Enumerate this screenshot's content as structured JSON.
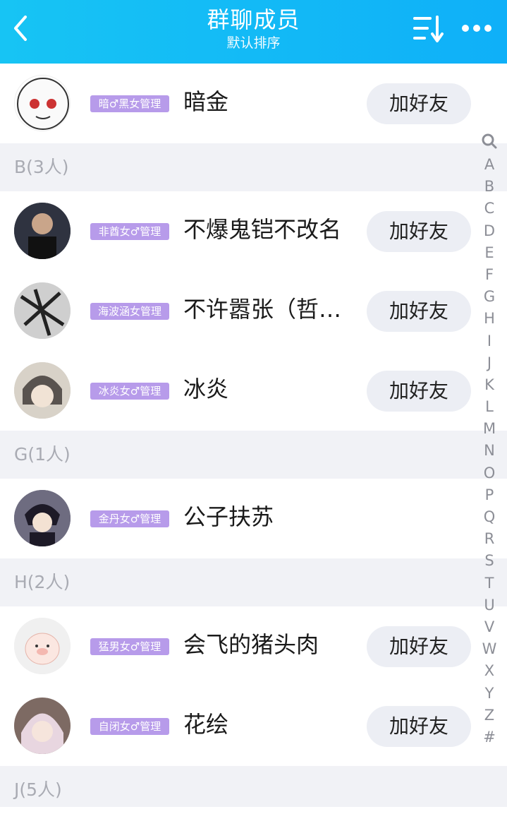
{
  "header": {
    "title": "群聊成员",
    "subtitle": "默认排序"
  },
  "members_top": {
    "name": "暗金",
    "badge": "暗♂黑女管理",
    "action": "加好友"
  },
  "sections": [
    {
      "label": "B(3人)"
    },
    {
      "label": "G(1人)"
    },
    {
      "label": "H(2人)"
    },
    {
      "label": "J(5人)"
    }
  ],
  "members": [
    {
      "name": "不爆鬼铠不改名",
      "badge": "非酋女♂管理",
      "action": "加好友"
    },
    {
      "name": "不许嚣张（哲…",
      "badge": "海波涵女管理",
      "action": "加好友"
    },
    {
      "name": "冰炎",
      "badge": "冰炎女♂管理",
      "action": "加好友"
    },
    {
      "name": "公子扶苏",
      "badge": "金丹女♂管理",
      "action": ""
    },
    {
      "name": "会飞的猪头肉",
      "badge": "猛男女♂管理",
      "action": "加好友"
    },
    {
      "name": "花绘",
      "badge": "自闭女♂管理",
      "action": "加好友"
    }
  ],
  "index_letters": [
    "A",
    "B",
    "C",
    "D",
    "E",
    "F",
    "G",
    "H",
    "I",
    "J",
    "K",
    "L",
    "M",
    "N",
    "O",
    "P",
    "Q",
    "R",
    "S",
    "T",
    "U",
    "V",
    "W",
    "X",
    "Y",
    "Z",
    "#"
  ],
  "colors": {
    "header": "#17c4f4",
    "badge": "#b79bea",
    "section_bg": "#f1f2f6"
  }
}
